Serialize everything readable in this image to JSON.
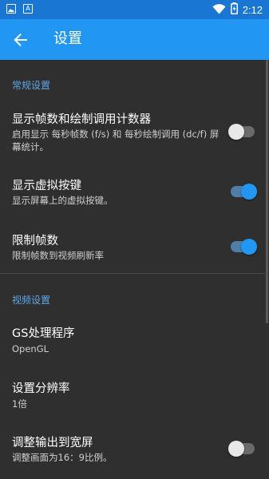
{
  "status_bar": {
    "time": "2:12",
    "left_icons": [
      "image-icon",
      "font-download-icon"
    ],
    "right_icons": [
      "wifi-icon",
      "battery-charging-icon"
    ]
  },
  "app_bar": {
    "title": "设置",
    "back_icon": "arrow-back-icon"
  },
  "sections": [
    {
      "header": "常规设置",
      "items": [
        {
          "title": "显示帧数和绘制调用计数器",
          "summary": "启用显示 每秒帧数 (f/s) 和 每秒绘制调用 (dc/f) 屏幕统计。",
          "switch": false
        },
        {
          "title": "显示虚拟按键",
          "summary": "显示屏幕上的虚拟按键。",
          "switch": true
        },
        {
          "title": "限制帧数",
          "summary": "限制帧数到视频刷新率",
          "switch": true
        }
      ]
    },
    {
      "header": "视频设置",
      "items": [
        {
          "title": "GS处理程序",
          "summary": "OpenGL"
        },
        {
          "title": "设置分辨率",
          "summary": "1倍"
        },
        {
          "title": "调整输出到宽屏",
          "summary": "调整画面为16：9比例。",
          "switch": false
        }
      ]
    }
  ],
  "colors": {
    "status_bar": "#1976d2",
    "app_bar": "#2196f3",
    "background": "#2f2f2f",
    "section_header": "#5ea7ea",
    "switch_on": "#2196f3"
  }
}
